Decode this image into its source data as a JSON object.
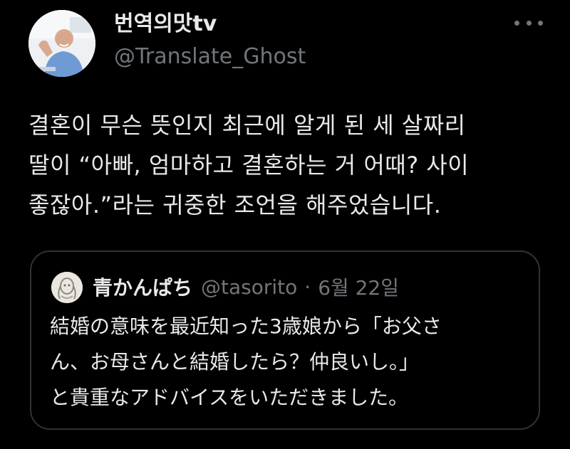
{
  "tweet": {
    "display_name": "번역의맛tv",
    "handle": "@Translate_Ghost",
    "more_icon": "more-horizontal-icon",
    "text_lines": [
      "결혼이 무슨 뜻인지 최근에 알게 된 세 살짜리",
      "딸이 “아빠, 엄마하고 결혼하는 거 어때? 사이",
      "좋잖아.”라는 귀중한 조언을 해주었습니다."
    ]
  },
  "quoted_tweet": {
    "display_name": "青かんぱち",
    "handle": "@tasorito",
    "separator": "·",
    "date": "6월 22일",
    "text_lines": [
      "結婚の意味を最近知った3歳娘から「お父さ",
      "ん、お母さんと結婚したら？仲良いし。」",
      "と貴重なアドバイスをいただきました。"
    ]
  },
  "colors": {
    "background": "#000000",
    "primary_text": "#e7e9ea",
    "secondary_text": "#71767b",
    "border": "#2f3336"
  }
}
